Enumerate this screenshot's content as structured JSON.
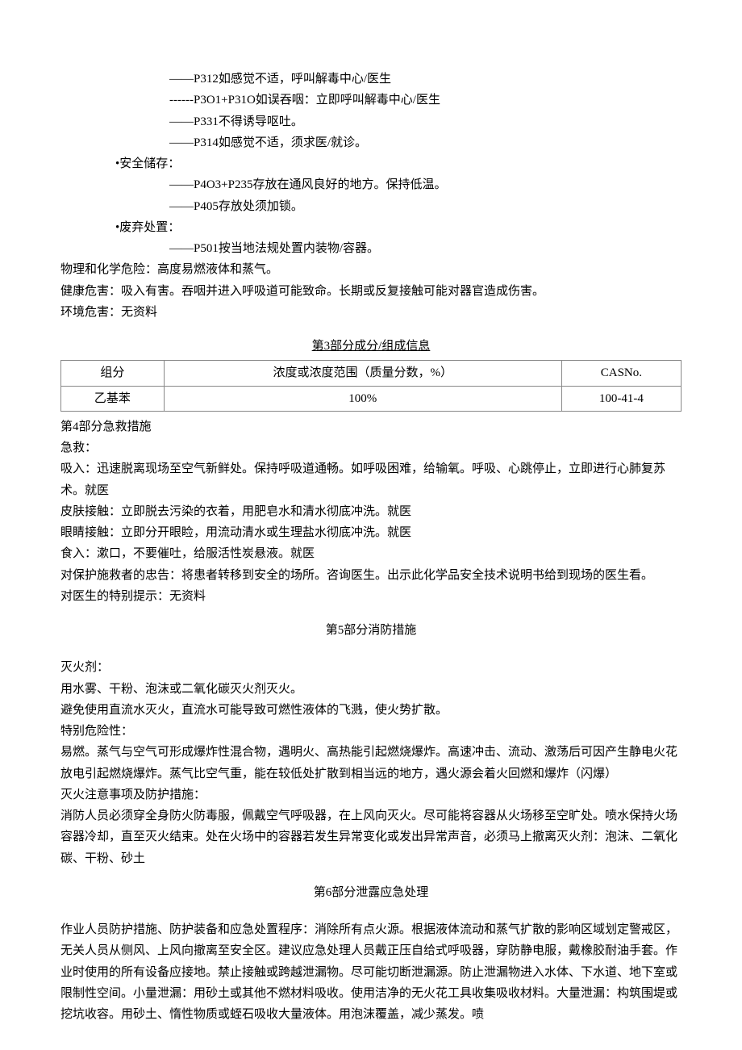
{
  "intro": {
    "lines": [
      "——P312如感觉不适，呼叫解毒中心/医生",
      "------P3O1+P31O如误吞咽：立即呼叫解毒中心/医生",
      "——P331不得诱导呕吐。",
      "——P314如感觉不适，须求医/就诊。"
    ],
    "storage_label": "•安全储存：",
    "storage_lines": [
      "——P4O3+P235存放在通风良好的地方。保持低温。",
      "——P405存放处须加锁。"
    ],
    "disposal_label": "•废弃处置：",
    "disposal_lines": [
      "——P501按当地法规处置内装物/容器。"
    ],
    "phys_chem": "物理和化学危险：高度易燃液体和蒸气。",
    "health": "健康危害：吸入有害。吞咽并进入呼吸道可能致命。长期或反复接触可能对器官造成伤害。",
    "env": "环境危害：无资料"
  },
  "sec3": {
    "heading": "第3部分成分/组成信息",
    "headers": [
      "组分",
      "浓度或浓度范围（质量分数，%）",
      "CASNo."
    ],
    "row": [
      "乙基苯",
      "100%",
      "100-41-4"
    ]
  },
  "sec4": {
    "heading": "第4部分急救措施",
    "lines": [
      "急救：",
      "吸入：迅速脱离现场至空气新鲜处。保持呼吸道通畅。如呼吸困难，给输氧。呼吸、心跳停止，立即进行心肺复苏术。就医",
      "皮肤接触：立即脱去污染的衣着，用肥皂水和清水彻底冲洗。就医",
      "眼睛接触：立即分开眼睑，用流动清水或生理盐水彻底冲洗。就医",
      "食入：漱口，不要催吐，给服活性炭悬液。就医",
      "对保护施救者的忠告：将患者转移到安全的场所。咨询医生。出示此化学品安全技术说明书给到现场的医生看。",
      "对医生的特别提示：无资料"
    ]
  },
  "sec5": {
    "heading": "第5部分消防措施",
    "lines": [
      "灭火剂：",
      "用水雾、干粉、泡沫或二氧化碳灭火剂灭火。",
      "避免使用直流水灭火，直流水可能导致可燃性液体的飞溅，使火势扩散。",
      "特别危险性：",
      "易燃。蒸气与空气可形成爆炸性混合物，遇明火、高热能引起燃烧爆炸。高速冲击、流动、激荡后可因产生静电火花放电引起燃烧爆炸。蒸气比空气重，能在较低处扩散到相当远的地方，遇火源会着火回燃和爆炸（闪爆）",
      "灭火注意事项及防护措施：",
      "消防人员必须穿全身防火防毒服，佩戴空气呼吸器，在上风向灭火。尽可能将容器从火场移至空旷处。喷水保持火场容器冷却，直至灭火结束。处在火场中的容器若发生异常变化或发出异常声音，必须马上撤离灭火剂：泡沫、二氧化碳、干粉、砂土"
    ]
  },
  "sec6": {
    "heading": "第6部分泄露应急处理",
    "para": "作业人员防护措施、防护装备和应急处置程序：消除所有点火源。根据液体流动和蒸气扩散的影响区域划定警戒区，无关人员从侧风、上风向撤离至安全区。建议应急处理人员戴正压自给式呼吸器，穿防静电服，戴橡胶耐油手套。作业时使用的所有设备应接地。禁止接触或跨越泄漏物。尽可能切断泄漏源。防止泄漏物进入水体、下水道、地下室或限制性空间。小量泄漏：用砂土或其他不燃材料吸收。使用洁净的无火花工具收集吸收材料。大量泄漏：构筑围堤或挖坑收容。用砂土、惰性物质或蛭石吸收大量液体。用泡沫覆盖，减少蒸发。喷"
  }
}
